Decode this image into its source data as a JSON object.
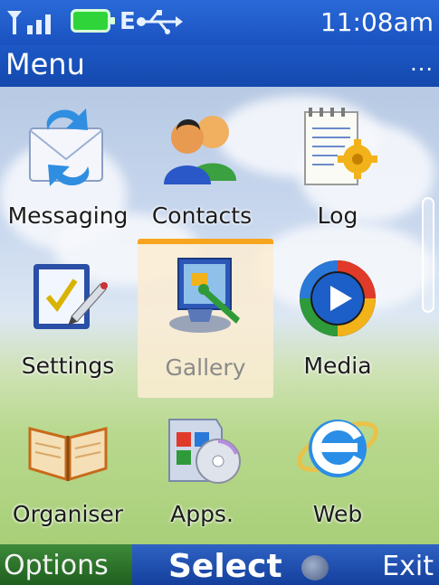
{
  "status_bar": {
    "time": "11:08am",
    "network_mode": "E"
  },
  "title_bar": {
    "title": "Menu",
    "more_indicator": "..."
  },
  "menu_items": [
    {
      "label": "Messaging",
      "icon": "messaging-icon"
    },
    {
      "label": "Contacts",
      "icon": "contacts-icon"
    },
    {
      "label": "Log",
      "icon": "log-icon"
    },
    {
      "label": "Settings",
      "icon": "settings-icon"
    },
    {
      "label": "Gallery",
      "icon": "gallery-icon",
      "selected": true
    },
    {
      "label": "Media",
      "icon": "media-icon"
    },
    {
      "label": "Organiser",
      "icon": "organiser-icon"
    },
    {
      "label": "Apps.",
      "icon": "apps-icon"
    },
    {
      "label": "Web",
      "icon": "web-icon"
    }
  ],
  "softkeys": {
    "left": "Options",
    "center": "Select",
    "right": "Exit"
  },
  "colors": {
    "status_blue": "#1a52c0",
    "selection_orange": "#f7a51e",
    "options_green": "#2f7a2c"
  }
}
